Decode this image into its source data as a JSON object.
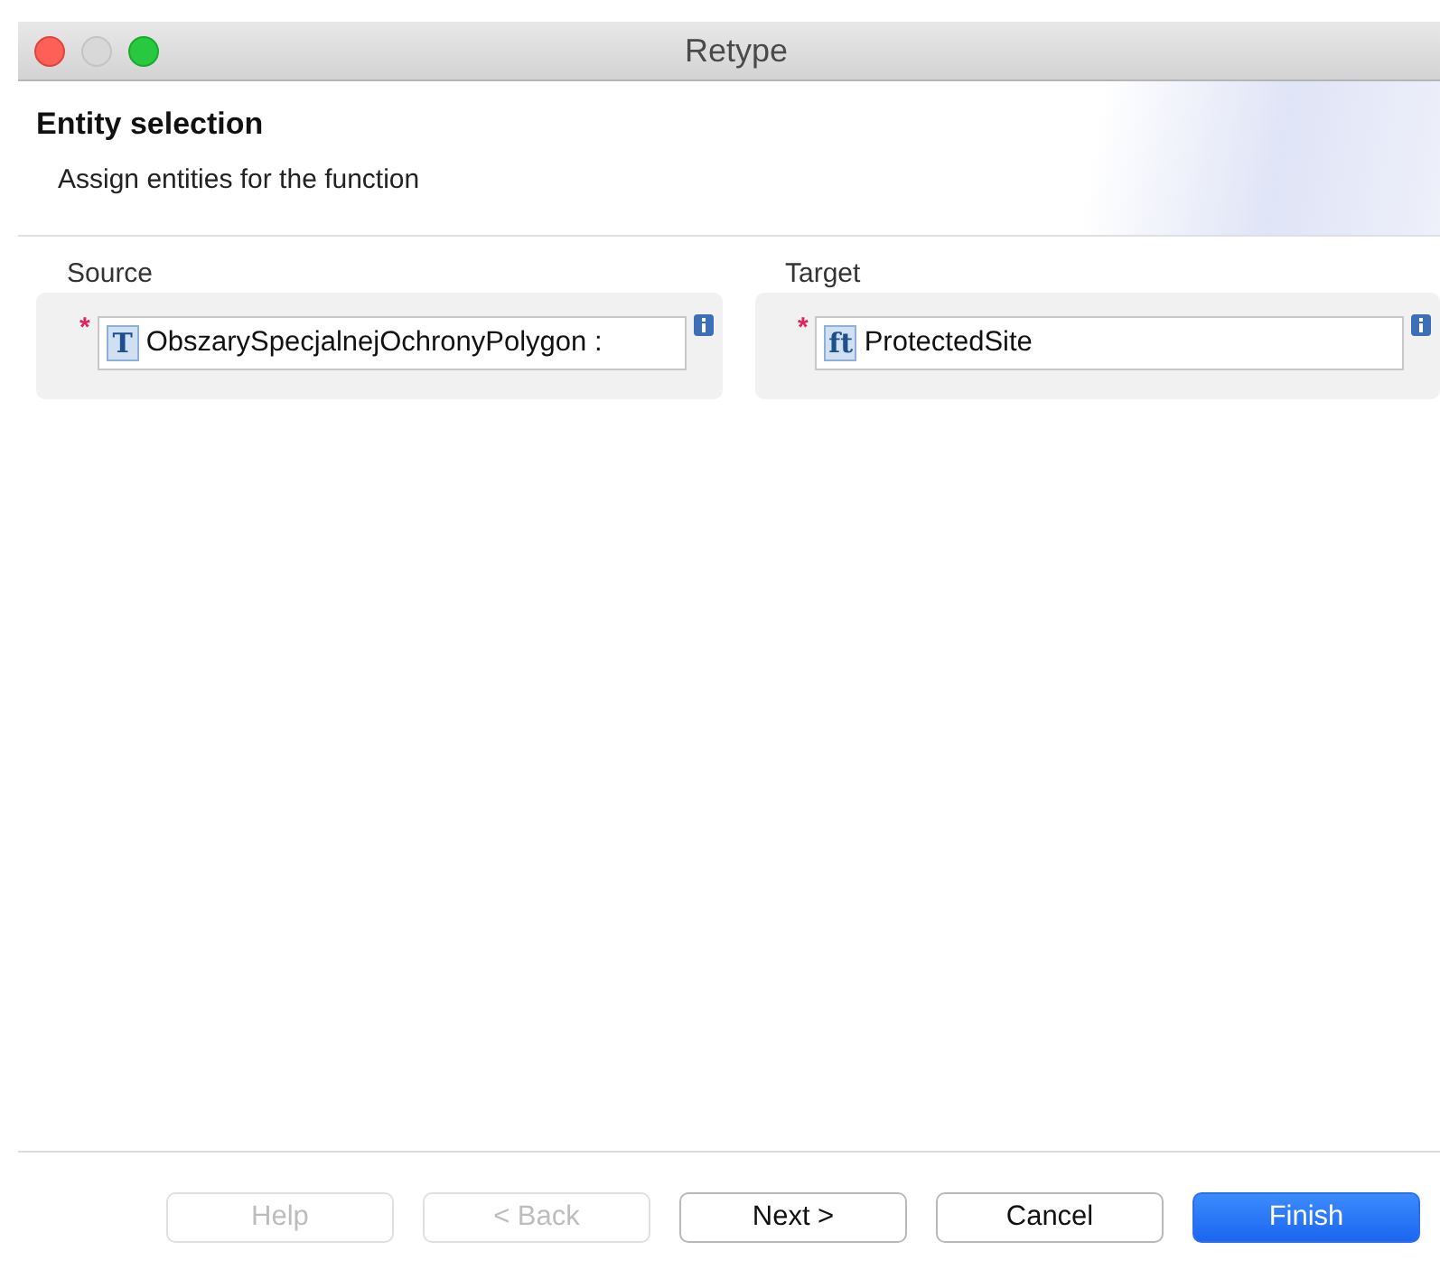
{
  "window": {
    "title": "Retype"
  },
  "header": {
    "title": "Entity selection",
    "subtitle": "Assign entities for the function"
  },
  "columns": [
    {
      "label": "Source",
      "required_mark": "*",
      "type_icon": "T",
      "value": "ObszarySpecjalnejOchronyPolygon :"
    },
    {
      "label": "Target",
      "required_mark": "*",
      "type_icon": "ft",
      "value": "ProtectedSite"
    }
  ],
  "buttons": [
    {
      "label": "Help",
      "disabled": true,
      "default": false
    },
    {
      "label": "< Back",
      "disabled": true,
      "default": false
    },
    {
      "label": "Next >",
      "disabled": false,
      "default": false
    },
    {
      "label": "Cancel",
      "disabled": false,
      "default": false
    },
    {
      "label": "Finish",
      "disabled": false,
      "default": true
    }
  ]
}
